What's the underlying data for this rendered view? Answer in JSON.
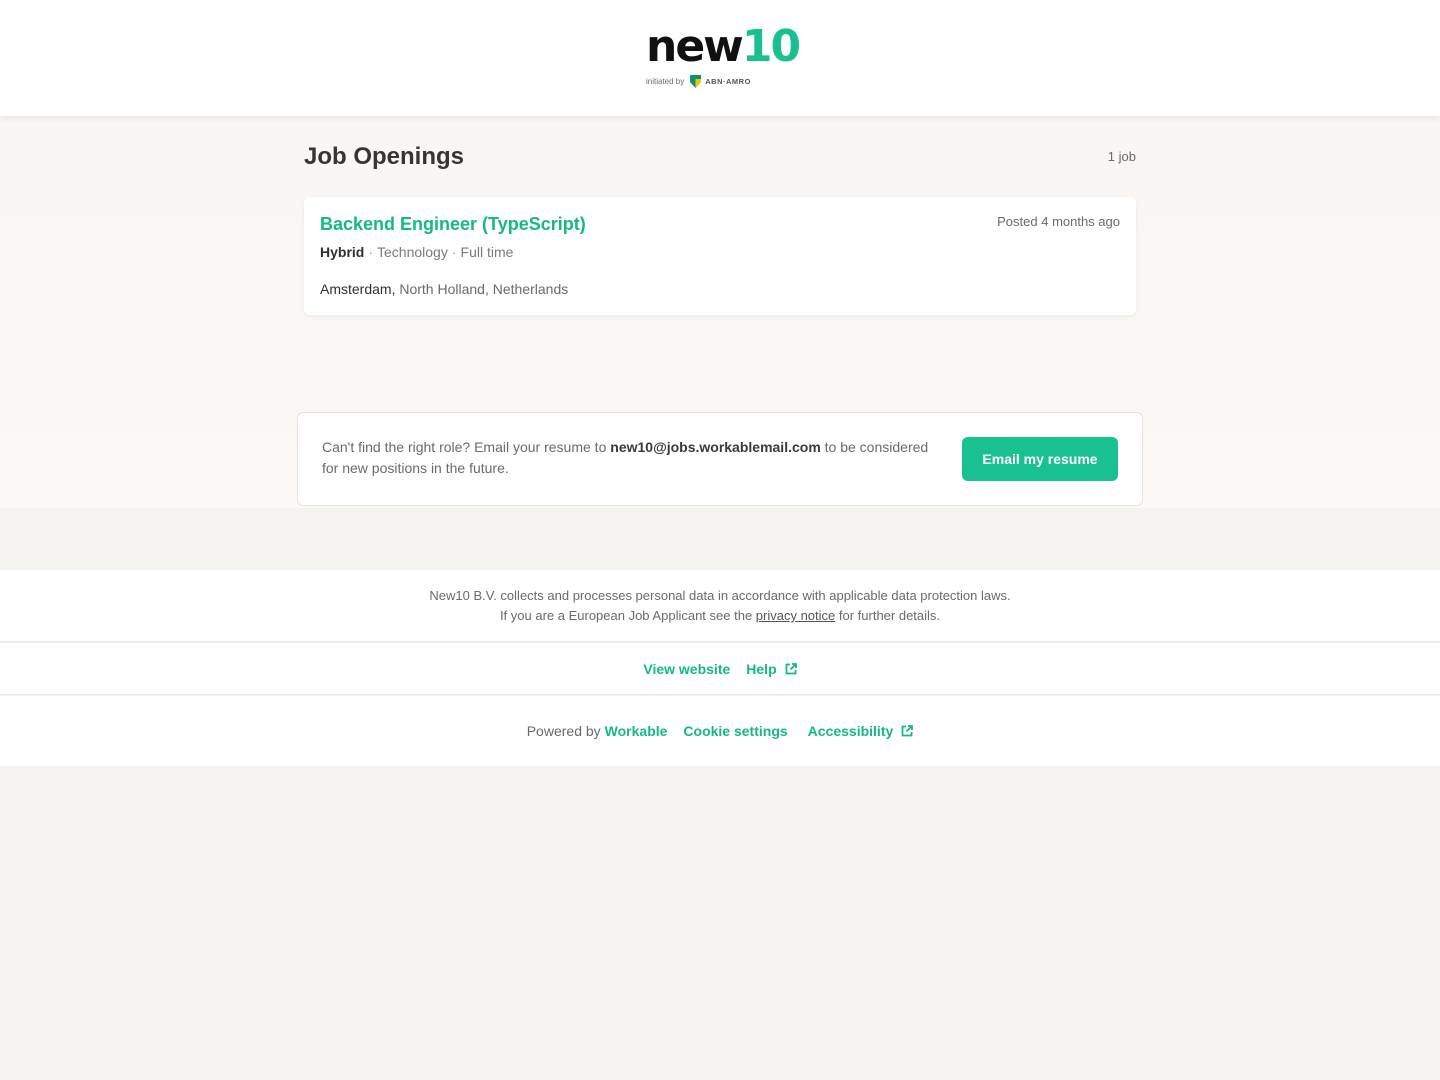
{
  "header": {
    "logo_word": "new",
    "logo_number": "10",
    "logo_initiated": "initiated by",
    "logo_bank": "ABN·AMRO"
  },
  "main": {
    "title": "Job Openings",
    "job_count": "1 job",
    "jobs": [
      {
        "title": "Backend Engineer (TypeScript)",
        "posted": "Posted 4 months ago",
        "workplace": "Hybrid",
        "department": "Technology",
        "type": "Full time",
        "city": "Amsterdam,",
        "region": "North Holland, Netherlands"
      }
    ]
  },
  "resume": {
    "text_before": "Can't find the right role? Email your resume to ",
    "email": "new10@jobs.workablemail.com",
    "text_after": " to be considered for new positions in the future.",
    "button_label": "Email my resume"
  },
  "privacy": {
    "line1": "New10 B.V. collects and processes personal data in accordance with applicable data protection laws.",
    "line2_before": "If you are a European Job Applicant see the ",
    "link": "privacy notice",
    "line2_after": " for further details."
  },
  "links": {
    "view_website": "View website",
    "help": "Help"
  },
  "footer": {
    "powered_by": "Powered by",
    "brand": "Workable",
    "cookie": "Cookie settings",
    "accessibility": "Accessibility"
  },
  "colors": {
    "accent": "#19c090",
    "link_text": "#15b886",
    "page_bg": "#f5f3f0",
    "hero_bg": "#f9f6f3"
  },
  "icons": {
    "external": "external-link-icon",
    "shield": "abn-amro-shield-icon"
  }
}
